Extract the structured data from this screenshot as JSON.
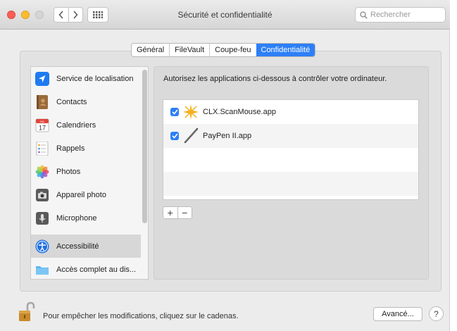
{
  "window": {
    "title": "Sécurité et confidentialité",
    "search_placeholder": "Rechercher"
  },
  "tabs": [
    {
      "label": "Général",
      "active": false
    },
    {
      "label": "FileVault",
      "active": false
    },
    {
      "label": "Coupe-feu",
      "active": false
    },
    {
      "label": "Confidentialité",
      "active": true
    }
  ],
  "sidebar": {
    "items": [
      {
        "label": "Service de localisation",
        "icon": "location-icon",
        "selected": false
      },
      {
        "label": "Contacts",
        "icon": "contacts-icon",
        "selected": false
      },
      {
        "label": "Calendriers",
        "icon": "calendar-icon",
        "selected": false
      },
      {
        "label": "Rappels",
        "icon": "reminders-icon",
        "selected": false
      },
      {
        "label": "Photos",
        "icon": "photos-icon",
        "selected": false
      },
      {
        "label": "Appareil photo",
        "icon": "camera-icon",
        "selected": false
      },
      {
        "label": "Microphone",
        "icon": "microphone-icon",
        "selected": false
      },
      {
        "label": "Accessibilité",
        "icon": "accessibility-icon",
        "selected": true
      },
      {
        "label": "Accès complet au dis...",
        "icon": "folder-icon",
        "selected": false
      }
    ],
    "calendar_icon_month": "JUL",
    "calendar_icon_day": "17"
  },
  "main": {
    "description": "Autorisez les applications ci-dessous à contrôler votre ordinateur.",
    "apps": [
      {
        "name": "CLX.ScanMouse.app",
        "checked": true,
        "icon": "scanmouse-icon"
      },
      {
        "name": "PayPen II.app",
        "checked": true,
        "icon": "paypen-icon"
      }
    ],
    "add_label": "+",
    "remove_label": "−"
  },
  "footer": {
    "lock_text": "Pour empêcher les modifications, cliquez sur le cadenas.",
    "advanced_label": "Avancé...",
    "help_label": "?"
  },
  "colors": {
    "accent": "#2d7ff7",
    "close": "#fc5f57",
    "minimize": "#fdbc2e"
  }
}
